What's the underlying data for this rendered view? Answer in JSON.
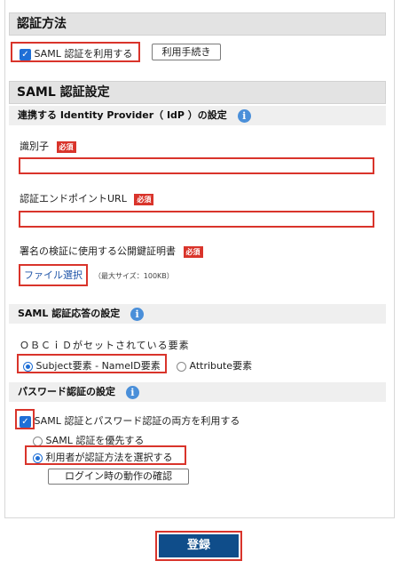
{
  "auth_method": {
    "title": "認証方法",
    "use_saml_label": "SAML 認証を利用する",
    "use_saml_checked": true,
    "procedure_button": "利用手続き"
  },
  "saml_settings": {
    "title": "SAML 認証設定",
    "idp_heading": "連携する Identity Provider（ IdP ）の設定",
    "identifier_label": "識別子",
    "identifier_value": "",
    "endpoint_label": "認証エンドポイントURL",
    "endpoint_value": "",
    "cert_label": "署名の検証に使用する公開鍵証明書",
    "required_badge": "必須",
    "file_select_button": "ファイル選択",
    "file_max_size": "（最大サイズ：100KB）"
  },
  "saml_response": {
    "heading": "SAML 認証応答の設定",
    "obcid_label": "ＯＢＣｉＤがセットされている要素",
    "options": [
      {
        "label": "Subject要素 - NameID要素",
        "selected": true
      },
      {
        "label": "Attribute要素",
        "selected": false
      }
    ]
  },
  "password_auth": {
    "heading": "パスワード認証の設定",
    "use_both_label": "SAML 認証とパスワード認証の両方を利用する",
    "use_both_checked": true,
    "options": [
      {
        "label": "SAML 認証を優先する",
        "selected": false
      },
      {
        "label": "利用者が認証方法を選択する",
        "selected": true
      }
    ],
    "login_behavior_button": "ログイン時の動作の確認"
  },
  "footer": {
    "submit_label": "登録"
  },
  "colors": {
    "accent_red": "#d9342b",
    "primary_blue": "#0f4d8a",
    "check_blue": "#1f6fd6",
    "info_blue": "#4a8fd9"
  }
}
